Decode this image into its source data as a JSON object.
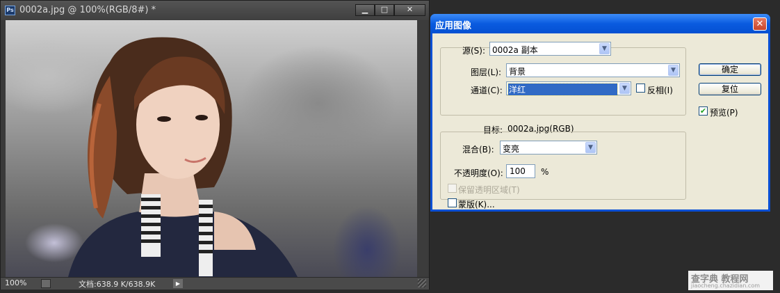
{
  "document_window": {
    "app_icon": "Ps",
    "title": "0002a.jpg @ 100%(RGB/8#) *",
    "controls": {
      "minimize_icon": "minimize-icon",
      "maximize_icon": "maximize-icon",
      "close_icon": "close-icon"
    },
    "status": {
      "zoom": "100%",
      "doc_info": "文档:638.9 K/638.9K"
    }
  },
  "dialog": {
    "title": "应用图像",
    "source": {
      "label": "源(S):",
      "value": "0002a 副本"
    },
    "layer": {
      "label": "图层(L):",
      "value": "背景"
    },
    "channel": {
      "label": "通道(C):",
      "value": "洋红"
    },
    "invert": {
      "label": "反相(I)",
      "checked": false
    },
    "target": {
      "label": "目标:",
      "value": "0002a.jpg(RGB)"
    },
    "blending": {
      "label": "混合(B):",
      "value": "变亮"
    },
    "opacity": {
      "label": "不透明度(O):",
      "value": "100",
      "unit": "%"
    },
    "preserve_transparency": {
      "label": "保留透明区域(T)",
      "checked": false,
      "disabled": true
    },
    "mask": {
      "label": "蒙版(K)...",
      "checked": false
    },
    "buttons": {
      "ok": "确定",
      "reset": "复位"
    },
    "preview": {
      "label": "预览(P)",
      "checked": true
    }
  },
  "watermark": {
    "line1": "查字典 教程网",
    "line2": "jiaocheng.chazidian.com"
  }
}
